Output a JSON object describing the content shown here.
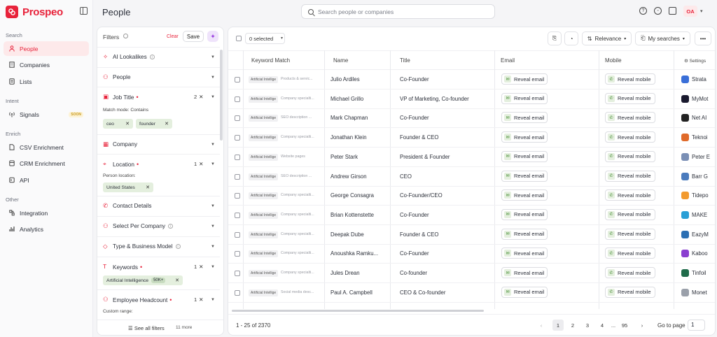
{
  "app": {
    "name": "Prospeo"
  },
  "header": {
    "title": "People",
    "search_placeholder": "Search people or companies",
    "avatar": "OA"
  },
  "sidebar": {
    "sections": [
      {
        "label": "Search",
        "items": [
          {
            "label": "People",
            "icon": "person-icon",
            "active": true
          },
          {
            "label": "Companies",
            "icon": "building-icon"
          },
          {
            "label": "Lists",
            "icon": "list-icon"
          }
        ]
      },
      {
        "label": "Intent",
        "items": [
          {
            "label": "Signals",
            "icon": "signal-icon",
            "badge": "SOON"
          }
        ]
      },
      {
        "label": "Enrich",
        "items": [
          {
            "label": "CSV Enrichment",
            "icon": "csv-icon"
          },
          {
            "label": "CRM Enrichment",
            "icon": "crm-icon"
          },
          {
            "label": "API",
            "icon": "api-icon"
          }
        ]
      },
      {
        "label": "Other",
        "items": [
          {
            "label": "Integration",
            "icon": "integration-icon"
          },
          {
            "label": "Analytics",
            "icon": "analytics-icon"
          }
        ]
      }
    ]
  },
  "filters": {
    "title": "Filters",
    "clear": "Clear",
    "save": "Save",
    "items": [
      {
        "label": "AI Lookalikes",
        "info": true
      },
      {
        "label": "People"
      },
      {
        "label": "Job Title",
        "required": true,
        "count": "2",
        "sub": "Match mode: Contains",
        "chips": [
          "ceo",
          "founder"
        ]
      },
      {
        "label": "Company"
      },
      {
        "label": "Location",
        "required": true,
        "count": "1",
        "sub": "Person location:",
        "chips": [
          "United States"
        ]
      },
      {
        "label": "Contact Details"
      },
      {
        "label": "Select Per Company",
        "info": true
      },
      {
        "label": "Type & Business Model",
        "info": true
      },
      {
        "label": "Keywords",
        "required": true,
        "count": "1",
        "chips": [
          "Artificial Intelligence"
        ],
        "chip_tag": "50K+"
      },
      {
        "label": "Employee Headcount",
        "required": true,
        "count": "1",
        "sub": "Custom range:"
      }
    ],
    "see_all": "See all filters",
    "more": "11 more"
  },
  "toolbar": {
    "selected": "0 selected",
    "sort": "Relevance",
    "searches": "My searches"
  },
  "columns": {
    "keyword": "Keyword Match",
    "name": "Name",
    "title": "Title",
    "email": "Email",
    "mobile": "Mobile",
    "settings": "Settings"
  },
  "reveal_email": "Reveal email",
  "reveal_mobile": "Reveal mobile",
  "rows": [
    {
      "kw": "Artificial Intellige",
      "kwd": "Products & servic...",
      "name": "Julio Ardiles",
      "title": "Co-Founder",
      "company": "Strata",
      "logo": "#3a6fd8"
    },
    {
      "kw": "Artificial Intellige",
      "kwd": "Company specialti...",
      "name": "Michael Grillo",
      "title": "VP of Marketing, Co-founder",
      "company": "MyMot",
      "logo": "#1a1a2e"
    },
    {
      "kw": "Artificial Intellige",
      "kwd": "SEO description ...",
      "name": "Mark Chapman",
      "title": "Co-Founder",
      "company": "Net AI",
      "logo": "#222222"
    },
    {
      "kw": "Artificial Intellige",
      "kwd": "Company specialti...",
      "name": "Jonathan Klein",
      "title": "Founder & CEO",
      "company": "Teknoi",
      "logo": "#e06a2a"
    },
    {
      "kw": "Artificial Intellige",
      "kwd": "Website pages",
      "name": "Peter Stark",
      "title": "President & Founder",
      "company": "Peter E",
      "logo": "#7a8fb5"
    },
    {
      "kw": "Artificial Intellige",
      "kwd": "SEO description ...",
      "name": "Andrew Girson",
      "title": "CEO",
      "company": "Barr G",
      "logo": "#4a7bbd"
    },
    {
      "kw": "Artificial Intellige",
      "kwd": "Company specialti...",
      "name": "George Consagra",
      "title": "Co-Founder/CEO",
      "company": "Tidepo",
      "logo": "#f29a2e"
    },
    {
      "kw": "Artificial Intellige",
      "kwd": "Company specialti...",
      "name": "Brian Kottenstette",
      "title": "Co-Founder",
      "company": "MAKE",
      "logo": "#2a9fd6"
    },
    {
      "kw": "Artificial Intellige",
      "kwd": "Company specialti...",
      "name": "Deepak Dube",
      "title": "Founder & CEO",
      "company": "EazyM",
      "logo": "#2b6fb3"
    },
    {
      "kw": "Artificial Intellige",
      "kwd": "Company specialti...",
      "name": "Anoushka Ramku...",
      "title": "Co-Founder",
      "company": "Kaboo",
      "logo": "#8a3fd0"
    },
    {
      "kw": "Artificial Intellige",
      "kwd": "Company specialti...",
      "name": "Jules Drean",
      "title": "Co-founder",
      "company": "Tinfoil",
      "logo": "#1f6b4a"
    },
    {
      "kw": "Artificial Intellige",
      "kwd": "Social media desc...",
      "name": "Paul A. Campbell",
      "title": "CEO & Co-founder",
      "company": "Monet",
      "logo": "#9aa0aa"
    }
  ],
  "pagination": {
    "range": "1 - 25 of 2370",
    "pages": [
      "1",
      "2",
      "3",
      "4",
      "...",
      "95"
    ],
    "goto_label": "Go to page",
    "goto_value": "1"
  }
}
